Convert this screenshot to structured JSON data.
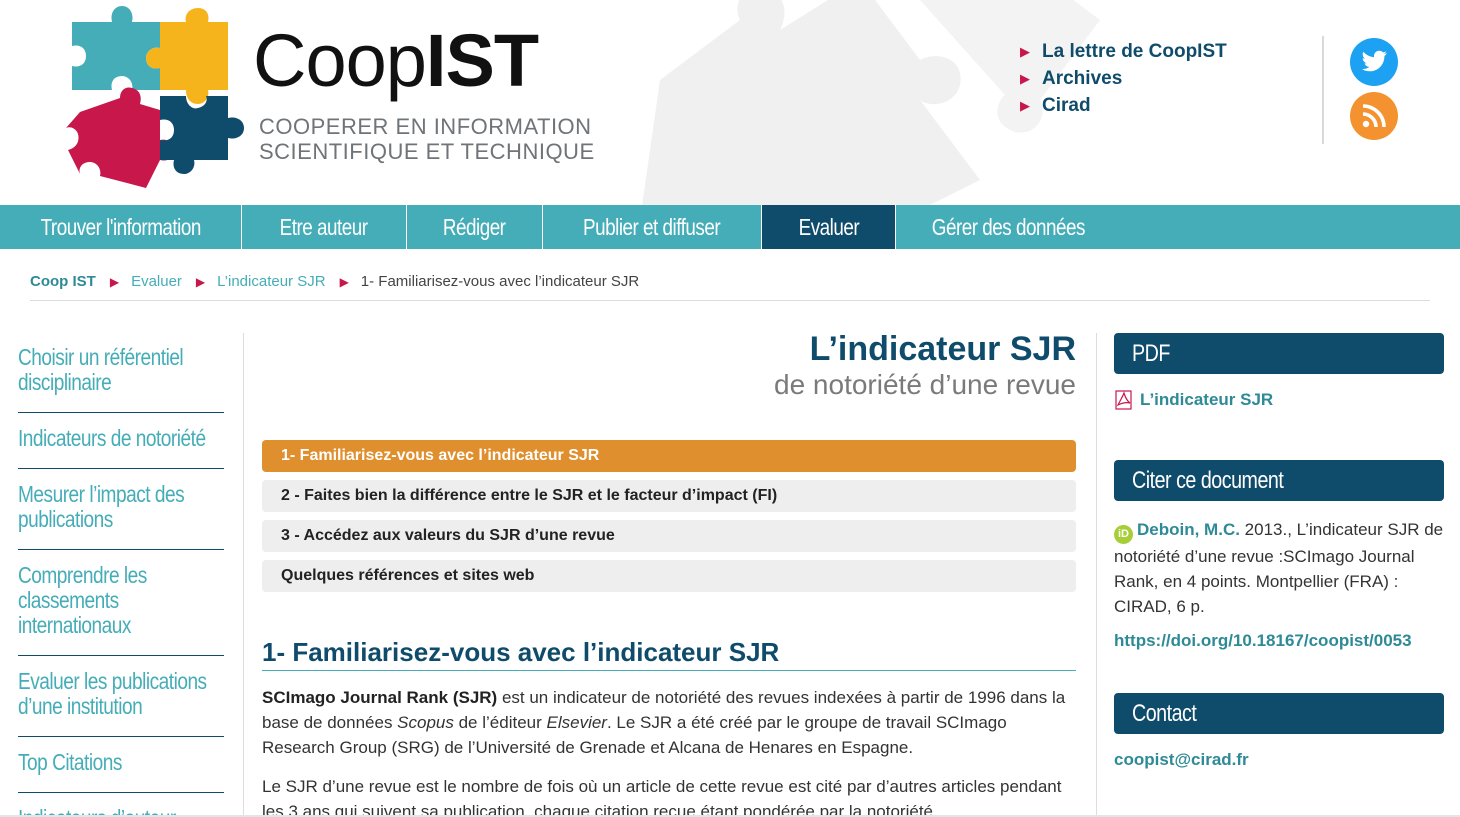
{
  "header": {
    "logo_light": "Coop",
    "logo_bold": "IST",
    "tagline_line1": "COOPERER EN INFORMATION",
    "tagline_line2": "SCIENTIFIQUE ET TECHNIQUE",
    "links": [
      "La lettre de CoopIST",
      "Archives",
      "Cirad"
    ],
    "social": [
      "twitter-icon",
      "rss-icon"
    ]
  },
  "nav": {
    "items": [
      "Trouver l'information",
      "Etre auteur",
      "Rédiger",
      "Publier et diffuser",
      "Evaluer",
      "Gérer des données"
    ],
    "active": "Evaluer"
  },
  "breadcrumb": {
    "items": [
      "Coop IST",
      "Evaluer",
      "L’indicateur SJR",
      "1- Familiarisez-vous avec l’indicateur SJR"
    ]
  },
  "sidebar": {
    "items": [
      "Choisir un référentiel disciplinaire",
      "Indicateurs de notoriété",
      "Mesurer l’impact des publications",
      "Comprendre les classements internationaux",
      "Evaluer les publications d’une institution",
      "Top Citations",
      "Indicateurs d’auteur"
    ]
  },
  "main": {
    "title": "L’indicateur SJR",
    "subtitle": "de notoriété d’une revue",
    "toc": [
      "1- Familiarisez-vous avec l’indicateur SJR",
      "2 - Faites bien la différence entre le SJR et le facteur d’impact (FI)",
      "3 - Accédez aux valeurs du SJR d’une revue",
      "Quelques références et sites web"
    ],
    "section_title": "1- Familiarisez-vous avec l’indicateur SJR",
    "p1_bold": "SCImago Journal Rank (SJR)",
    "p1_a": " est un indicateur de notoriété des revues indexées à partir de 1996 dans la base de données ",
    "p1_scopus": "Scopus",
    "p1_b": " de l’éditeur ",
    "p1_elsevier": "Elsevier",
    "p1_c": ". Le SJR a été créé par le groupe de travail SCImago Research Group (SRG) de l’Université de Grenade et Alcana de Henares en Espagne.",
    "p2": "Le SJR d’une revue est le nombre de fois où un article de cette revue est cité par d’autres articles pendant les 3 ans qui suivent sa publication, chaque citation reçue étant pondérée par la notoriété"
  },
  "right": {
    "pdf_heading": "PDF",
    "pdf_link": "L’indicateur SJR",
    "cite_heading": "Citer ce document",
    "cite_author": "Deboin, M.C.",
    "cite_text": " 2013., L’indicateur SJR de notoriété d’une revue :SCImago Journal Rank, en 4 points. Montpellier (FRA) : CIRAD, 6 p.",
    "doi": "https://doi.org/10.18167/coopist/0053",
    "contact_heading": "Contact",
    "email": "coopist@cirad.fr"
  },
  "colors": {
    "teal": "#45adb8",
    "navy": "#0f4b6b",
    "orange": "#e08f2e",
    "crimson": "#c7174b"
  }
}
